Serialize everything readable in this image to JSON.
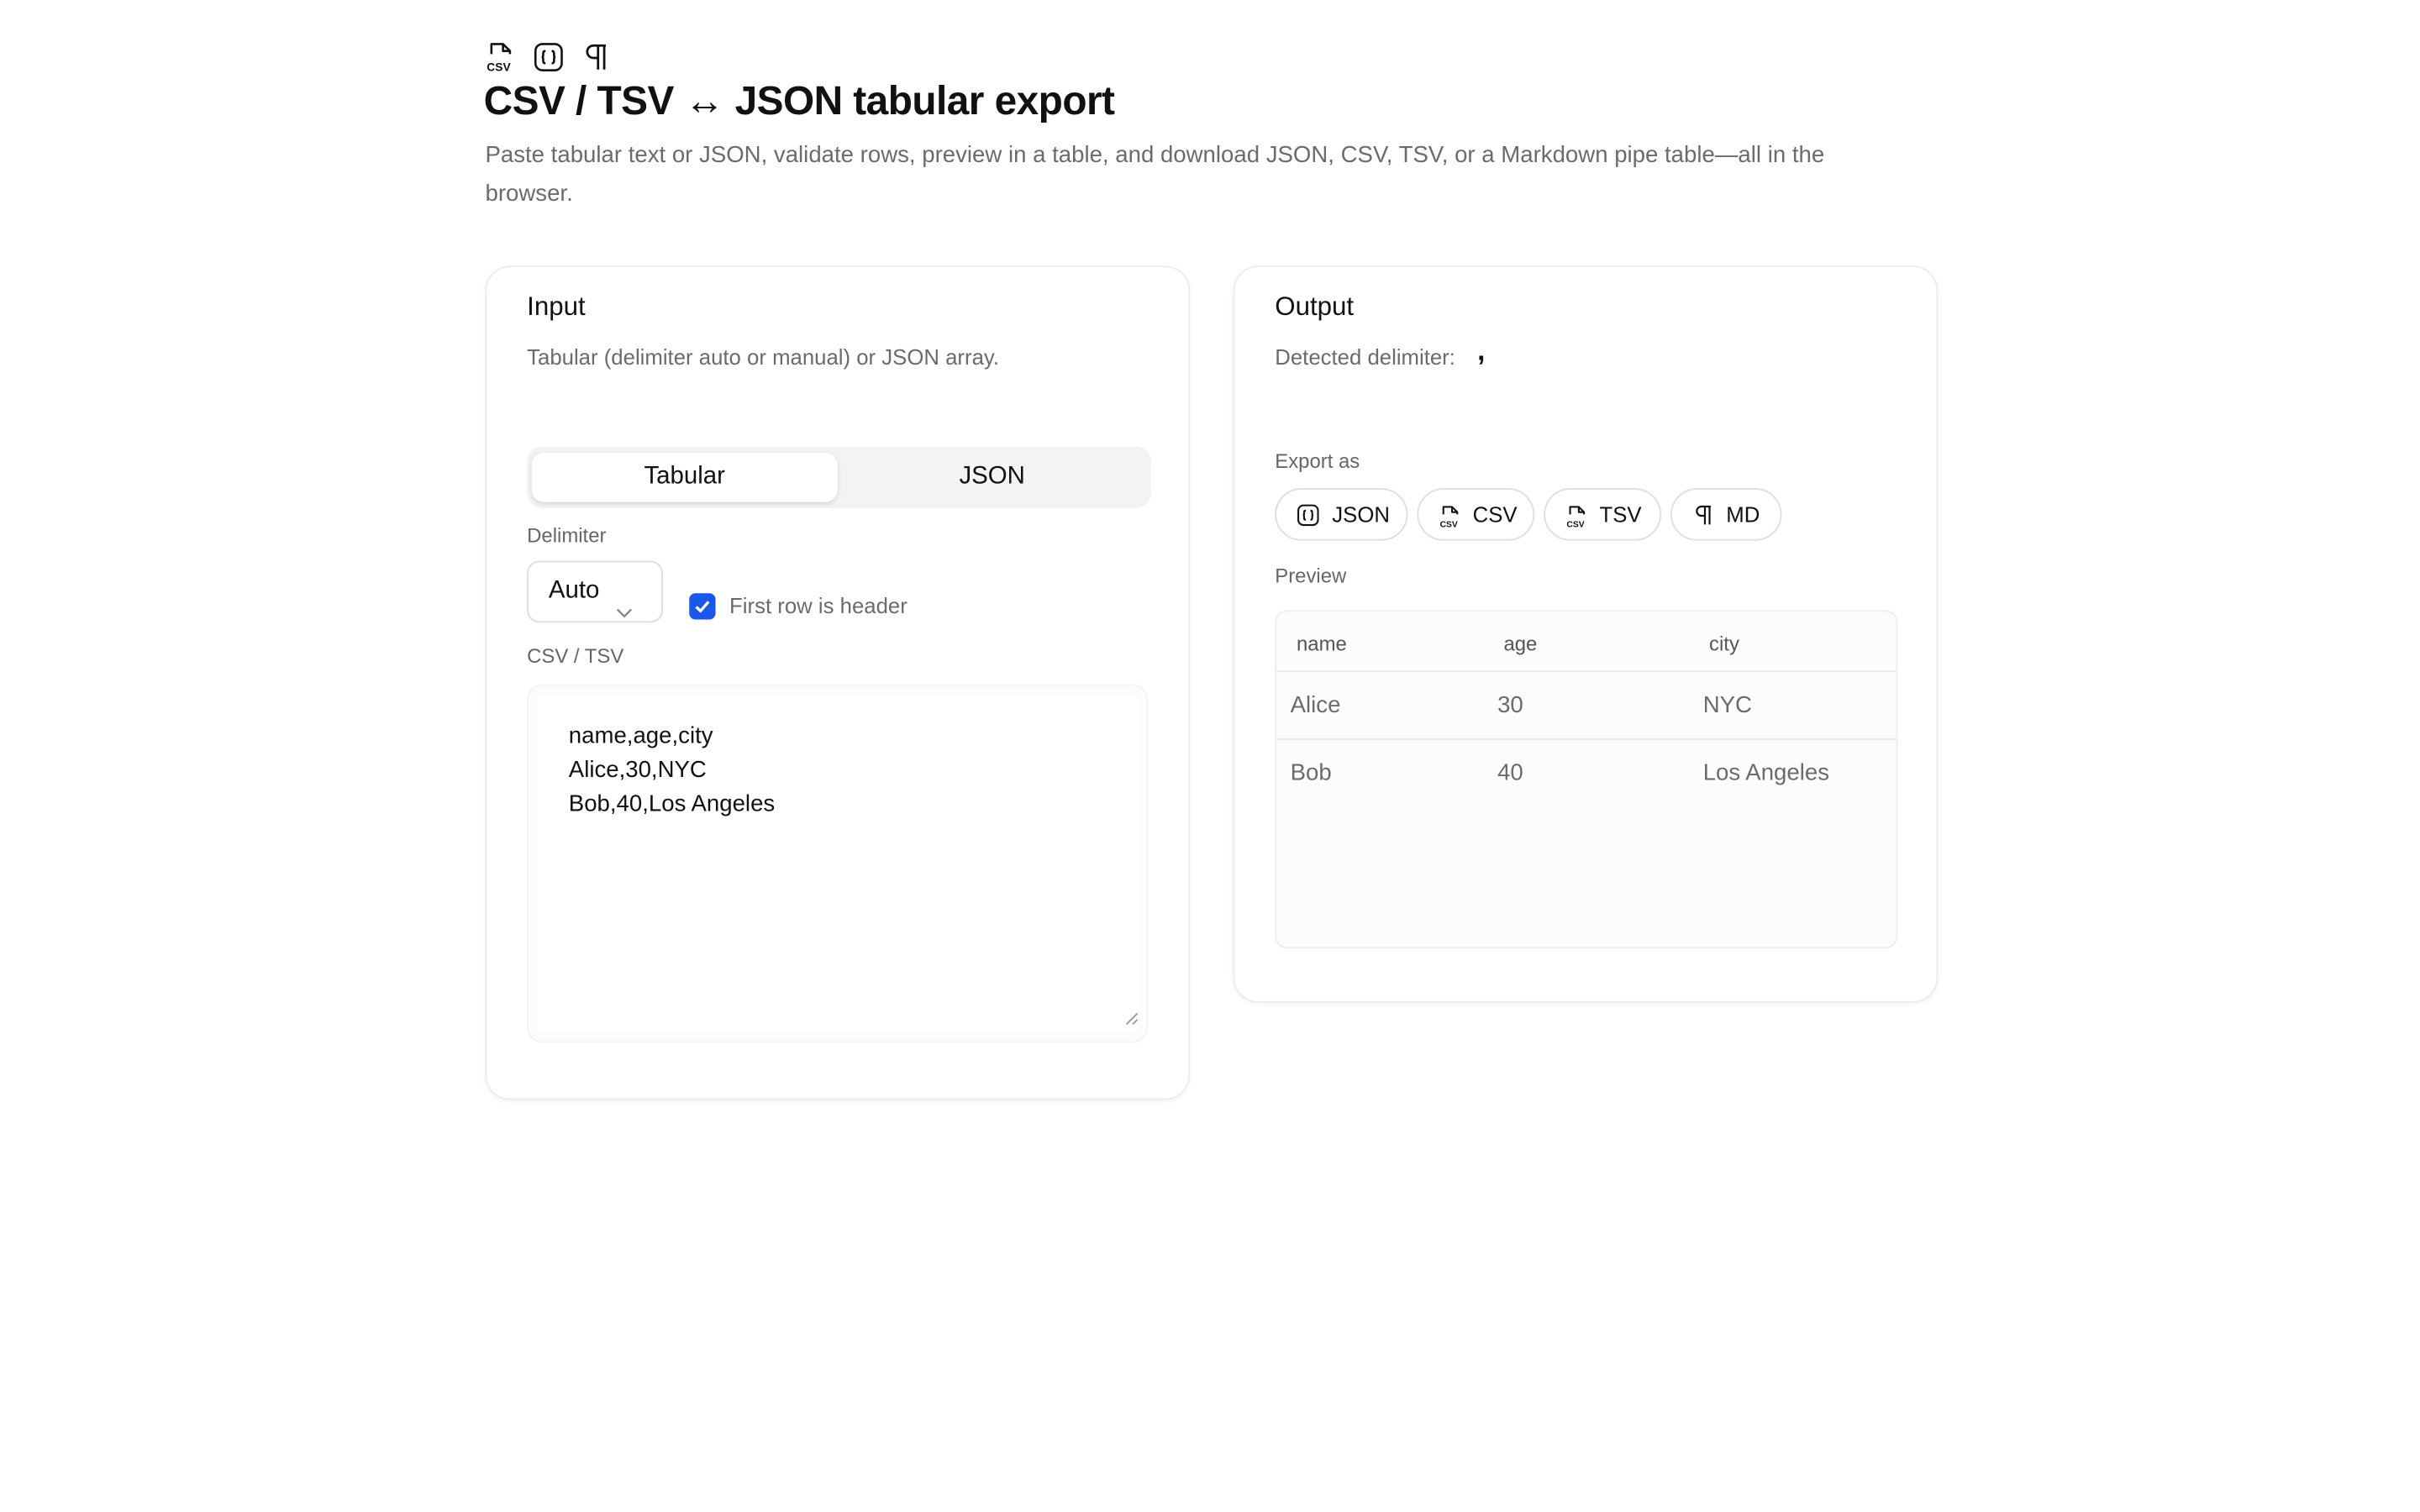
{
  "header": {
    "icons": [
      "file-csv-icon",
      "braces-icon",
      "pilcrow-icon"
    ],
    "title": "CSV / TSV ↔ JSON tabular export",
    "description": "Paste tabular text or JSON, validate rows, preview in a table, and download JSON, CSV, TSV, or a Markdown pipe table—all in the browser."
  },
  "input": {
    "title": "Input",
    "subtitle": "Tabular (delimiter auto or manual) or JSON array.",
    "modes": [
      "Tabular",
      "JSON"
    ],
    "active_mode": "Tabular",
    "delimiter_label": "Delimiter",
    "delimiter_value": "Auto",
    "header_checkbox_label": "First row is header",
    "header_checkbox_checked": true,
    "textarea_label": "CSV / TSV",
    "textarea_lines": [
      "name,age,city",
      "Alice,30,NYC",
      "Bob,40,Los Angeles"
    ]
  },
  "output": {
    "title": "Output",
    "detected_label": "Detected delimiter:",
    "detected_value": ",",
    "export_label": "Export as",
    "export_buttons": [
      {
        "label": "JSON",
        "icon": "braces-icon"
      },
      {
        "label": "CSV",
        "icon": "file-csv-icon"
      },
      {
        "label": "TSV",
        "icon": "file-csv-icon"
      },
      {
        "label": "MD",
        "icon": "pilcrow-icon"
      }
    ],
    "preview_label": "Preview",
    "table": {
      "columns": [
        "name",
        "age",
        "city"
      ],
      "rows": [
        [
          "Alice",
          "30",
          "NYC"
        ],
        [
          "Bob",
          "40",
          "Los Angeles"
        ]
      ]
    }
  },
  "colors": {
    "accent": "#1b57e8",
    "muted_text": "#6b6b6b",
    "border": "#ececec"
  }
}
